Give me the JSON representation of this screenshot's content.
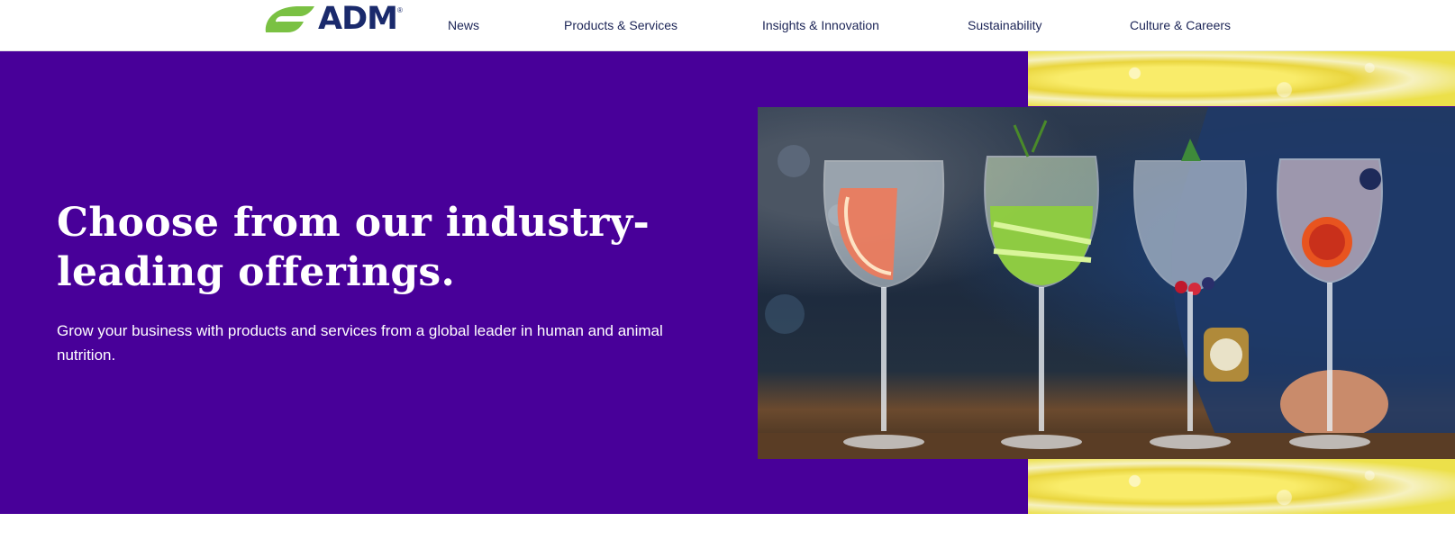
{
  "brand": {
    "name": "ADM",
    "registered_mark": "®",
    "colors": {
      "leaf_green": "#7ac143",
      "navy": "#1a2a6c",
      "hero_purple": "#480099"
    }
  },
  "nav": {
    "items": [
      {
        "label": "News"
      },
      {
        "label": "Products & Services"
      },
      {
        "label": "Insights & Innovation"
      },
      {
        "label": "Sustainability"
      },
      {
        "label": "Culture & Careers"
      }
    ]
  },
  "hero": {
    "title_line1": "Choose from our industry-",
    "title_line2": "leading offerings.",
    "subtitle": "Grow your business with products and services from a global leader in human and animal nutrition.",
    "image_icon": "cocktail-glasses-photo",
    "decor_icon": "lemon-slice-background"
  }
}
